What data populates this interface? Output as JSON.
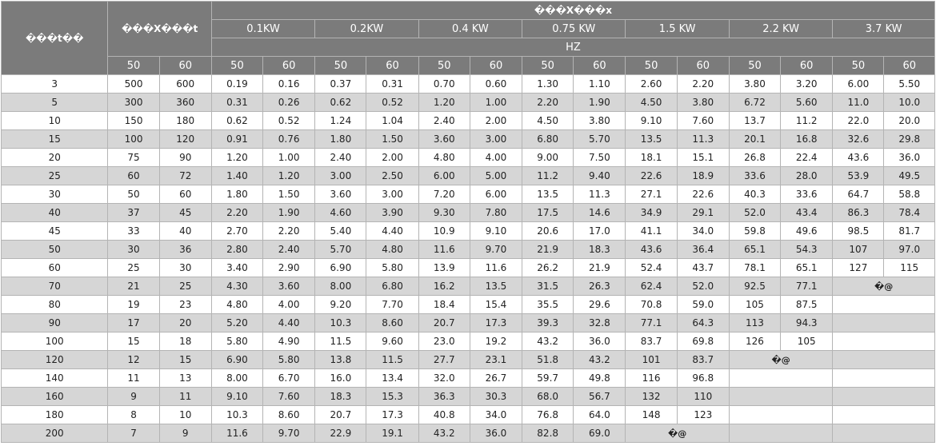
{
  "table": {
    "header_ratio_label": "���t��",
    "header_speed_label": "���X���t",
    "header_power_group": "���X���x",
    "powers": [
      "0.1KW",
      "0.2KW",
      "0.4 KW",
      "0.75 KW",
      "1.5 KW",
      "2.2 KW",
      "3.7 KW"
    ],
    "hz_label": "HZ",
    "freqs": [
      "50",
      "60"
    ],
    "na_mark": "�@",
    "rows": [
      [
        "3",
        "500",
        "600",
        "0.19",
        "0.16",
        "0.37",
        "0.31",
        "0.70",
        "0.60",
        "1.30",
        "1.10",
        "2.60",
        "2.20",
        "3.80",
        "3.20",
        "6.00",
        "5.50"
      ],
      [
        "5",
        "300",
        "360",
        "0.31",
        "0.26",
        "0.62",
        "0.52",
        "1.20",
        "1.00",
        "2.20",
        "1.90",
        "4.50",
        "3.80",
        "6.72",
        "5.60",
        "11.0",
        "10.0"
      ],
      [
        "10",
        "150",
        "180",
        "0.62",
        "0.52",
        "1.24",
        "1.04",
        "2.40",
        "2.00",
        "4.50",
        "3.80",
        "9.10",
        "7.60",
        "13.7",
        "11.2",
        "22.0",
        "20.0"
      ],
      [
        "15",
        "100",
        "120",
        "0.91",
        "0.76",
        "1.80",
        "1.50",
        "3.60",
        "3.00",
        "6.80",
        "5.70",
        "13.5",
        "11.3",
        "20.1",
        "16.8",
        "32.6",
        "29.8"
      ],
      [
        "20",
        "75",
        "90",
        "1.20",
        "1.00",
        "2.40",
        "2.00",
        "4.80",
        "4.00",
        "9.00",
        "7.50",
        "18.1",
        "15.1",
        "26.8",
        "22.4",
        "43.6",
        "36.0"
      ],
      [
        "25",
        "60",
        "72",
        "1.40",
        "1.20",
        "3.00",
        "2.50",
        "6.00",
        "5.00",
        "11.2",
        "9.40",
        "22.6",
        "18.9",
        "33.6",
        "28.0",
        "53.9",
        "49.5"
      ],
      [
        "30",
        "50",
        "60",
        "1.80",
        "1.50",
        "3.60",
        "3.00",
        "7.20",
        "6.00",
        "13.5",
        "11.3",
        "27.1",
        "22.6",
        "40.3",
        "33.6",
        "64.7",
        "58.8"
      ],
      [
        "40",
        "37",
        "45",
        "2.20",
        "1.90",
        "4.60",
        "3.90",
        "9.30",
        "7.80",
        "17.5",
        "14.6",
        "34.9",
        "29.1",
        "52.0",
        "43.4",
        "86.3",
        "78.4"
      ],
      [
        "45",
        "33",
        "40",
        "2.70",
        "2.20",
        "5.40",
        "4.40",
        "10.9",
        "9.10",
        "20.6",
        "17.0",
        "41.1",
        "34.0",
        "59.8",
        "49.6",
        "98.5",
        "81.7"
      ],
      [
        "50",
        "30",
        "36",
        "2.80",
        "2.40",
        "5.70",
        "4.80",
        "11.6",
        "9.70",
        "21.9",
        "18.3",
        "43.6",
        "36.4",
        "65.1",
        "54.3",
        "107",
        "97.0"
      ],
      [
        "60",
        "25",
        "30",
        "3.40",
        "2.90",
        "6.90",
        "5.80",
        "13.9",
        "11.6",
        "26.2",
        "21.9",
        "52.4",
        "43.7",
        "78.1",
        "65.1",
        "127",
        "115"
      ],
      [
        "70",
        "21",
        "25",
        "4.30",
        "3.60",
        "8.00",
        "6.80",
        "16.2",
        "13.5",
        "31.5",
        "26.3",
        "62.4",
        "52.0",
        "92.5",
        "77.1"
      ],
      [
        "80",
        "19",
        "23",
        "4.80",
        "4.00",
        "9.20",
        "7.70",
        "18.4",
        "15.4",
        "35.5",
        "29.6",
        "70.8",
        "59.0",
        "105",
        "87.5"
      ],
      [
        "90",
        "17",
        "20",
        "5.20",
        "4.40",
        "10.3",
        "8.60",
        "20.7",
        "17.3",
        "39.3",
        "32.8",
        "77.1",
        "64.3",
        "113",
        "94.3"
      ],
      [
        "100",
        "15",
        "18",
        "5.80",
        "4.90",
        "11.5",
        "9.60",
        "23.0",
        "19.2",
        "43.2",
        "36.0",
        "83.7",
        "69.8",
        "126",
        "105"
      ],
      [
        "120",
        "12",
        "15",
        "6.90",
        "5.80",
        "13.8",
        "11.5",
        "27.7",
        "23.1",
        "51.8",
        "43.2",
        "101",
        "83.7"
      ],
      [
        "140",
        "11",
        "13",
        "8.00",
        "6.70",
        "16.0",
        "13.4",
        "32.0",
        "26.7",
        "59.7",
        "49.8",
        "116",
        "96.8"
      ],
      [
        "160",
        "9",
        "11",
        "9.10",
        "7.60",
        "18.3",
        "15.3",
        "36.3",
        "30.3",
        "68.0",
        "56.7",
        "132",
        "110"
      ],
      [
        "180",
        "8",
        "10",
        "10.3",
        "8.60",
        "20.7",
        "17.3",
        "40.8",
        "34.0",
        "76.8",
        "64.0",
        "148",
        "123"
      ],
      [
        "200",
        "7",
        "9",
        "11.6",
        "9.70",
        "22.9",
        "19.1",
        "43.2",
        "36.0",
        "82.8",
        "69.0"
      ]
    ]
  }
}
